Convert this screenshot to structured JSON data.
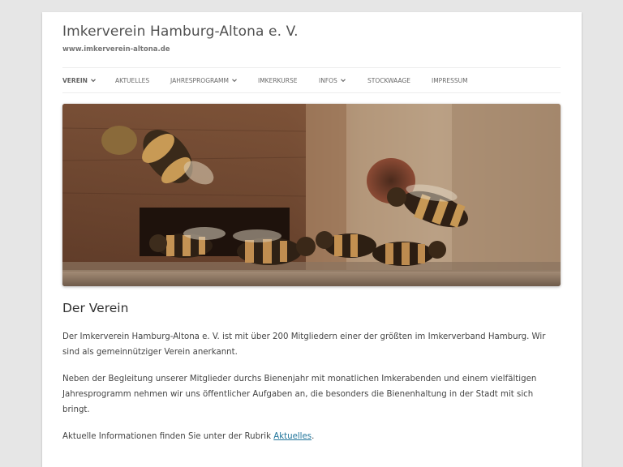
{
  "site": {
    "title": "Imkerverein Hamburg-Altona e. V.",
    "description": "www.imkerverein-altona.de"
  },
  "nav": {
    "items": [
      {
        "label": "Verein",
        "has_submenu": true,
        "current": true
      },
      {
        "label": "Aktuelles",
        "has_submenu": false,
        "current": false
      },
      {
        "label": "Jahresprogramm",
        "has_submenu": true,
        "current": false
      },
      {
        "label": "Imkerkurse",
        "has_submenu": false,
        "current": false
      },
      {
        "label": "Infos",
        "has_submenu": true,
        "current": false
      },
      {
        "label": "Stockwaage",
        "has_submenu": false,
        "current": false
      },
      {
        "label": "Impressum",
        "has_submenu": false,
        "current": false
      }
    ]
  },
  "hero": {
    "icon": "bees-at-hive-entrance-photo"
  },
  "content": {
    "title": "Der Verein",
    "paragraph1": "Der Imkerverein Hamburg-Altona e. V. ist mit über 200 Mitgliedern einer der größten im Imkerverband Hamburg. Wir sind als gemeinnütziger Verein anerkannt.",
    "paragraph2": "Neben der Begleitung unserer Mitglieder durchs Bienenjahr mit monatlichen Imkerabenden und einem vielfältigen Jahresprogramm nehmen wir uns öffentlicher Aufgaben an, die besonders die Bienenhaltung in der Stadt mit sich bringt.",
    "paragraph3_prefix": "Aktuelle Informationen finden Sie unter der Rubrik ",
    "paragraph3_link": "Aktuelles",
    "paragraph3_suffix": "."
  },
  "colors": {
    "background": "#e6e6e6",
    "page": "#ffffff",
    "link": "#21759b",
    "text": "#444444"
  }
}
